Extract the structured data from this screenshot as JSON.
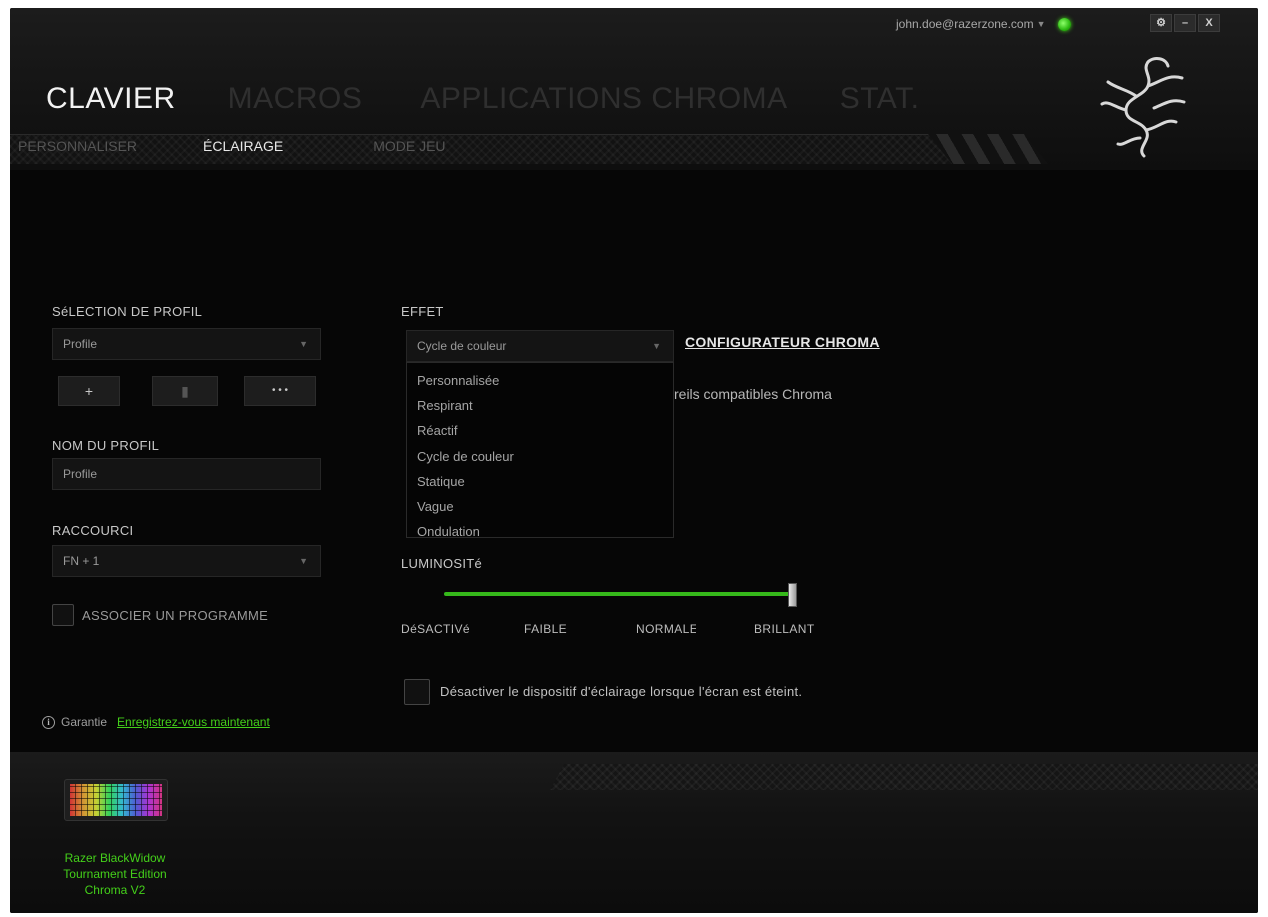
{
  "header": {
    "account_email": "john.doe@razerzone.com",
    "window_buttons": {
      "settings": "⚙",
      "minimize": "–",
      "close": "X"
    },
    "main_nav": [
      {
        "label": "CLAVIER",
        "active": true
      },
      {
        "label": "MACROS",
        "active": false
      },
      {
        "label": "APPLICATIONS CHROMA",
        "active": false
      },
      {
        "label": "STAT.",
        "active": false
      }
    ],
    "sub_nav": [
      {
        "label": "PERSONNALISER",
        "active": false
      },
      {
        "label": "ÉCLAIRAGE",
        "active": true
      },
      {
        "label": "MODE JEU",
        "active": false
      }
    ]
  },
  "profile": {
    "selection_label": "SéLECTION DE PROFIL",
    "selected_profile": "Profile",
    "buttons": {
      "add": "+",
      "delete": "▮",
      "more": "• • •"
    },
    "name_label": "NOM DU PROFIL",
    "name_value": "Profile",
    "shortcut_label": "RACCOURCI",
    "shortcut_value": "FN + 1",
    "associate_program_label": "ASSOCIER UN PROGRAMME"
  },
  "effect": {
    "label": "EFFET",
    "selected": "Cycle de couleur",
    "options": [
      "Personnalisée",
      "Respirant",
      "Réactif",
      "Cycle de couleur",
      "Statique",
      "Vague",
      "Ondulation"
    ],
    "chroma_configurator_link": "CONFIGURATEUR CHROMA",
    "partial_text": "reils compatibles Chroma"
  },
  "brightness": {
    "label": "LUMINOSITé",
    "level": "BRILLANT",
    "ticks": [
      "DéSACTIVé",
      "FAIBLE",
      "NORMALE",
      "BRILLANT"
    ]
  },
  "screen_off_option": {
    "label": "Désactiver le dispositif d'éclairage lorsque l'écran est éteint.",
    "checked": false
  },
  "warranty": {
    "label": "Garantie",
    "register_link": "Enregistrez-vous maintenant"
  },
  "device": {
    "name_lines": [
      "Razer BlackWidow",
      "Tournament Edition",
      "Chroma V2"
    ]
  },
  "colors": {
    "accent_green": "#44d01a",
    "slider_green": "#35b81a",
    "background": "#060606"
  }
}
